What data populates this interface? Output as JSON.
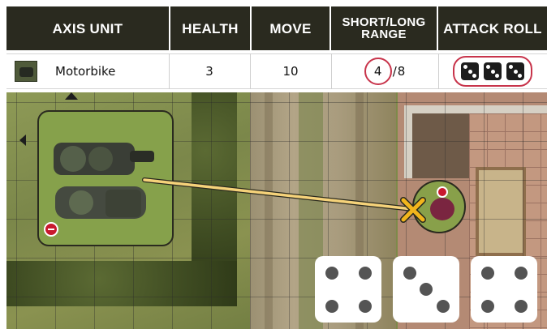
{
  "headers": {
    "unit": "AXIS UNIT",
    "health": "HEALTH",
    "move": "MOVE",
    "range_line1": "SHORT/LONG",
    "range_line2": "RANGE",
    "attack": "ATTACK ROLL"
  },
  "unit": {
    "name": "Motorbike",
    "health": "3",
    "move": "10",
    "range_short": "4",
    "range_sep": "/",
    "range_long": "8",
    "attack_dice": [
      3,
      3,
      3
    ]
  },
  "board_dice": [
    4,
    3,
    4
  ],
  "colors": {
    "header_bg": "#2a2a1f",
    "highlight": "#c8344b",
    "los_line": "#f5d27a",
    "target_marker": "#f2b51c"
  }
}
